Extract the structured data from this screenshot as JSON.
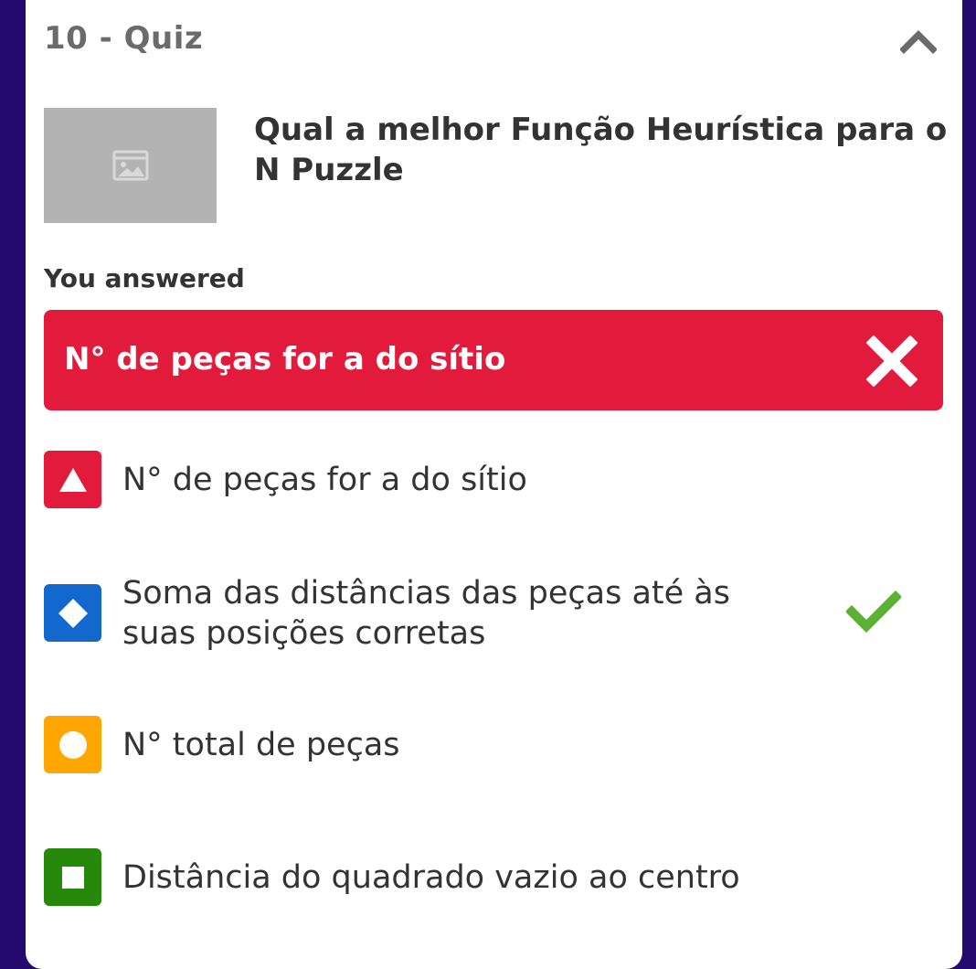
{
  "quiz": {
    "title": "10 - Quiz",
    "question": "Qual a melhor Função Heurística para o N Puzzle",
    "image_placeholder_icon": "image-icon"
  },
  "result": {
    "you_answered_label": "You answered",
    "selected_answer": "N° de peças for a do sítio",
    "status_icon": "close-icon",
    "status_color": "#e21b3c"
  },
  "options": [
    {
      "label": "N° de peças for a do sítio",
      "shape": "triangle-icon",
      "color": "#e21b3c",
      "correct": false
    },
    {
      "label": "Soma das distâncias das peças até às suas posições corretas",
      "shape": "diamond-icon",
      "color": "#1368ce",
      "correct": true
    },
    {
      "label": "N° total de peças",
      "shape": "circle-icon",
      "color": "#ffa602",
      "correct": false
    },
    {
      "label": "Distância do quadrado vazio ao centro",
      "shape": "square-icon",
      "color": "#26890c",
      "correct": false
    }
  ],
  "colors": {
    "background": "#24096e",
    "card": "#ffffff",
    "check": "#5cb135"
  }
}
